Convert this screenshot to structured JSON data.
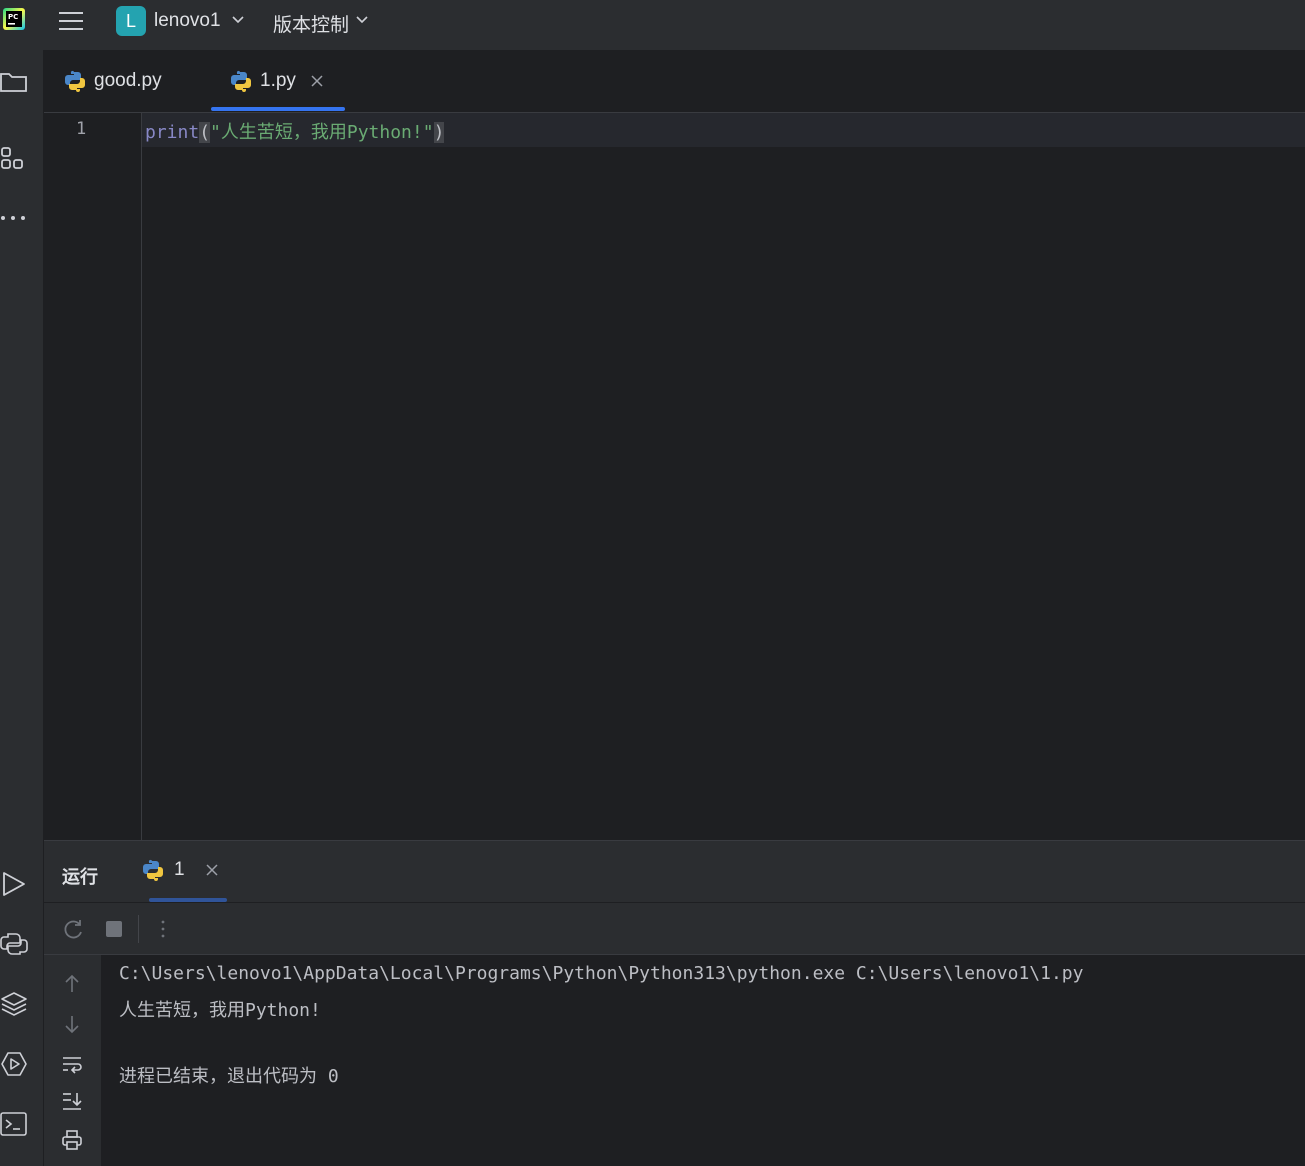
{
  "titlebar": {
    "project_initial": "L",
    "project_name": "lenovo1",
    "vcs_label": "版本控制"
  },
  "tabs": [
    {
      "label": "good.py",
      "active": false
    },
    {
      "label": "1.py",
      "active": true
    }
  ],
  "editor": {
    "line_number": "1",
    "code": {
      "fn": "print",
      "open_paren": "(",
      "string": "\"人生苦短，我用Python!\"",
      "close_paren": ")"
    }
  },
  "run_panel": {
    "title": "运行",
    "tab_label": "1",
    "console": [
      "C:\\Users\\lenovo1\\AppData\\Local\\Programs\\Python\\Python313\\python.exe C:\\Users\\lenovo1\\1.py",
      "人生苦短，我用Python!",
      "",
      "进程已结束，退出代码为 0"
    ]
  },
  "colors": {
    "accent": "#3574f0",
    "background": "#1e1f22",
    "panel": "#2b2d30",
    "string": "#6aab73",
    "function": "#8888c6"
  }
}
